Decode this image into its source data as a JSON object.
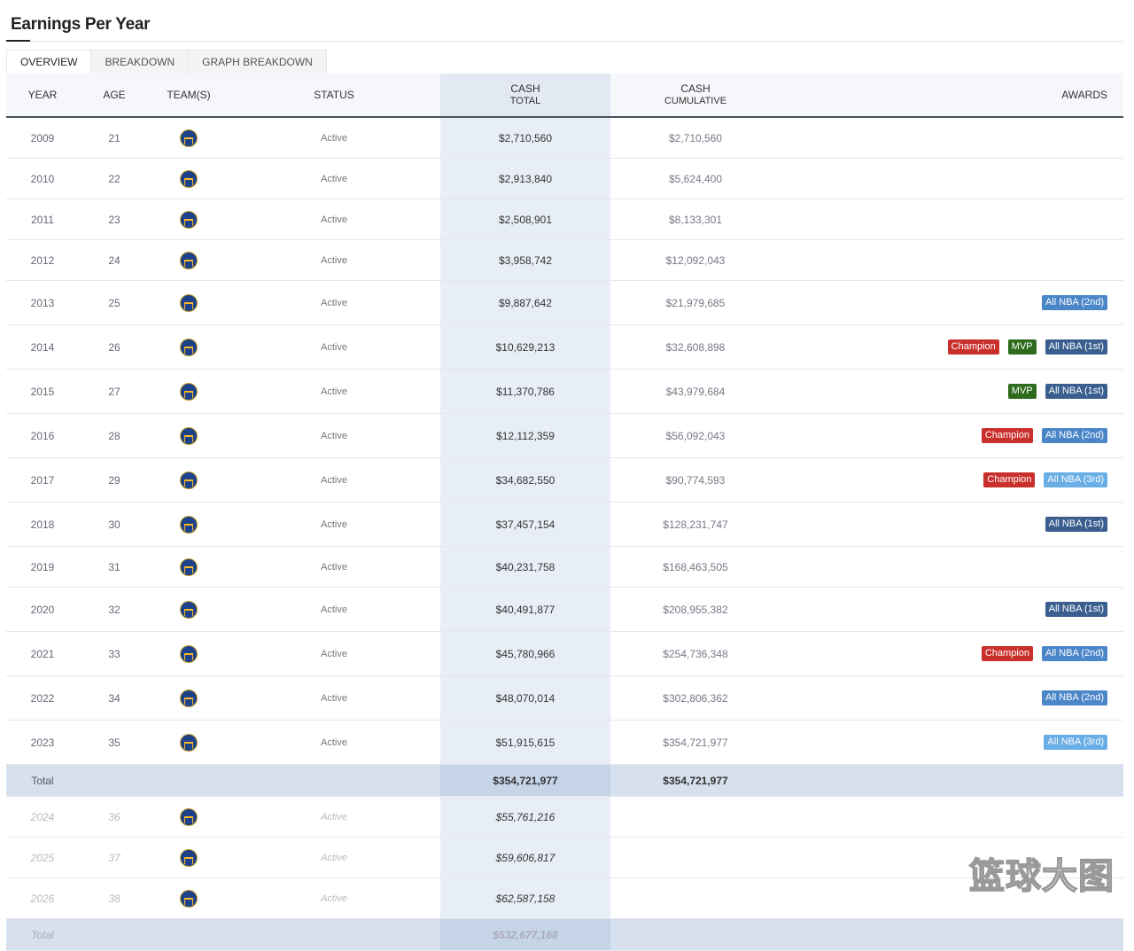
{
  "title": "Earnings Per Year",
  "tabs": [
    {
      "label": "OVERVIEW",
      "active": true
    },
    {
      "label": "BREAKDOWN",
      "active": false
    },
    {
      "label": "GRAPH BREAKDOWN",
      "active": false
    }
  ],
  "columns": {
    "year": "YEAR",
    "age": "AGE",
    "teams": "TEAM(S)",
    "status": "STATUS",
    "cash_total_1": "CASH",
    "cash_total_2": "TOTAL",
    "cash_cum_1": "CASH",
    "cash_cum_2": "CUMULATIVE",
    "awards": "AWARDS"
  },
  "badge_colors": {
    "Champion": "#c9302c",
    "MVP": "#2e6b1d",
    "All NBA (1st)": "#3a5f8f",
    "All NBA (2nd)": "#4a86c8",
    "All NBA (3rd)": "#6aaee6"
  },
  "rows": [
    {
      "year": "2009",
      "age": "21",
      "team": "warriors-logo",
      "status": "Active",
      "cash_total": "$2,710,560",
      "cash_cumulative": "$2,710,560",
      "awards": []
    },
    {
      "year": "2010",
      "age": "22",
      "team": "warriors-logo",
      "status": "Active",
      "cash_total": "$2,913,840",
      "cash_cumulative": "$5,624,400",
      "awards": []
    },
    {
      "year": "2011",
      "age": "23",
      "team": "warriors-logo",
      "status": "Active",
      "cash_total": "$2,508,901",
      "cash_cumulative": "$8,133,301",
      "awards": []
    },
    {
      "year": "2012",
      "age": "24",
      "team": "warriors-logo",
      "status": "Active",
      "cash_total": "$3,958,742",
      "cash_cumulative": "$12,092,043",
      "awards": []
    },
    {
      "year": "2013",
      "age": "25",
      "team": "warriors-logo",
      "status": "Active",
      "cash_total": "$9,887,642",
      "cash_cumulative": "$21,979,685",
      "awards": [
        "All NBA (2nd)"
      ]
    },
    {
      "year": "2014",
      "age": "26",
      "team": "warriors-logo",
      "status": "Active",
      "cash_total": "$10,629,213",
      "cash_cumulative": "$32,608,898",
      "awards": [
        "Champion",
        "MVP",
        "All NBA (1st)"
      ]
    },
    {
      "year": "2015",
      "age": "27",
      "team": "warriors-logo",
      "status": "Active",
      "cash_total": "$11,370,786",
      "cash_cumulative": "$43,979,684",
      "awards": [
        "MVP",
        "All NBA (1st)"
      ]
    },
    {
      "year": "2016",
      "age": "28",
      "team": "warriors-logo",
      "status": "Active",
      "cash_total": "$12,112,359",
      "cash_cumulative": "$56,092,043",
      "awards": [
        "Champion",
        "All NBA (2nd)"
      ]
    },
    {
      "year": "2017",
      "age": "29",
      "team": "warriors-logo",
      "status": "Active",
      "cash_total": "$34,682,550",
      "cash_cumulative": "$90,774,593",
      "awards": [
        "Champion",
        "All NBA (3rd)"
      ]
    },
    {
      "year": "2018",
      "age": "30",
      "team": "warriors-logo",
      "status": "Active",
      "cash_total": "$37,457,154",
      "cash_cumulative": "$128,231,747",
      "awards": [
        "All NBA (1st)"
      ]
    },
    {
      "year": "2019",
      "age": "31",
      "team": "warriors-logo",
      "status": "Active",
      "cash_total": "$40,231,758",
      "cash_cumulative": "$168,463,505",
      "awards": []
    },
    {
      "year": "2020",
      "age": "32",
      "team": "warriors-logo",
      "status": "Active",
      "cash_total": "$40,491,877",
      "cash_cumulative": "$208,955,382",
      "awards": [
        "All NBA (1st)"
      ]
    },
    {
      "year": "2021",
      "age": "33",
      "team": "warriors-logo",
      "status": "Active",
      "cash_total": "$45,780,966",
      "cash_cumulative": "$254,736,348",
      "awards": [
        "Champion",
        "All NBA (2nd)"
      ]
    },
    {
      "year": "2022",
      "age": "34",
      "team": "warriors-logo",
      "status": "Active",
      "cash_total": "$48,070,014",
      "cash_cumulative": "$302,806,362",
      "awards": [
        "All NBA (2nd)"
      ]
    },
    {
      "year": "2023",
      "age": "35",
      "team": "warriors-logo",
      "status": "Active",
      "cash_total": "$51,915,615",
      "cash_cumulative": "$354,721,977",
      "awards": [
        "All NBA (3rd)"
      ]
    }
  ],
  "total": {
    "label": "Total",
    "cash_total": "$354,721,977",
    "cash_cumulative": "$354,721,977"
  },
  "future_rows": [
    {
      "year": "2024",
      "age": "36",
      "team": "warriors-logo",
      "status": "Active",
      "cash_total": "$55,761,216"
    },
    {
      "year": "2025",
      "age": "37",
      "team": "warriors-logo",
      "status": "Active",
      "cash_total": "$59,606,817"
    },
    {
      "year": "2026",
      "age": "38",
      "team": "warriors-logo",
      "status": "Active",
      "cash_total": "$62,587,158"
    }
  ],
  "future_total": {
    "label": "Total",
    "cash_total": "$532,677,168"
  },
  "watermark": "篮球大图"
}
